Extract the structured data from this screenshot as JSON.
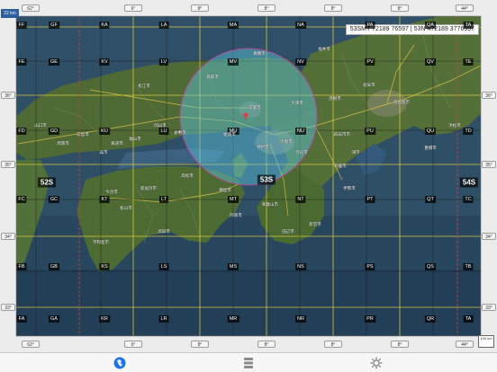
{
  "top_ticks": [
    "62°",
    "6°",
    "8°",
    "8°",
    "8°",
    "8°",
    "44°"
  ],
  "bottom_ticks": [
    "62°",
    "6°",
    "8°",
    "8°",
    "8°",
    "8°",
    "44°"
  ],
  "left_ticks": [
    "36°",
    "35°",
    "34°",
    "33°"
  ],
  "right_ticks": [
    "36°",
    "35°",
    "34°",
    "33°"
  ],
  "zoom_label": "22 km",
  "scale_label": "100 km",
  "coord_readout": "53SMT 72189 76597 | 53N 472189 3776597",
  "zone_labels": {
    "left": "52S",
    "center": "53S",
    "right": "54S"
  },
  "grid_squares": [
    [
      "FF",
      "GF",
      "KA",
      "LA",
      "MA",
      "NA",
      "PA",
      "QA",
      "TA"
    ],
    [
      "FE",
      "GE",
      "KV",
      "LV",
      "MV",
      "NV",
      "PV",
      "QV",
      "TE"
    ],
    [
      "FD",
      "GD",
      "KU",
      "LU",
      "MU",
      "NU",
      "PU",
      "QU",
      "TD"
    ],
    [
      "FC",
      "GC",
      "KT",
      "LT",
      "MT",
      "NT",
      "PT",
      "QT",
      "TC"
    ],
    [
      "FB",
      "GB",
      "KS",
      "LS",
      "MS",
      "NS",
      "PS",
      "QS",
      "TB"
    ],
    [
      "FA",
      "GA",
      "KR",
      "LR",
      "MR",
      "NR",
      "PR",
      "QR",
      "TA"
    ]
  ],
  "place_names": [
    "大阪市",
    "名古屋市",
    "京都市",
    "神戸市",
    "岡山市",
    "広島市",
    "高松市",
    "和歌山市",
    "松山市",
    "高知市",
    "徳島市",
    "奈良市",
    "津市",
    "岐阜市",
    "福井市",
    "鳥取市",
    "松江市",
    "福山市",
    "倉敷市",
    "姫路市",
    "豊橋市",
    "浜松市",
    "四日市市",
    "彦根市",
    "舞鶴市",
    "今治市",
    "新居浜市",
    "尾道市",
    "呉市",
    "山口市",
    "周南市",
    "宇和島市",
    "阿南市",
    "田辺市",
    "新宮市",
    "伊勢市",
    "鈴鹿市",
    "大津市"
  ],
  "tabbar": {
    "items": [
      {
        "icon": "globe-icon",
        "active": true
      },
      {
        "icon": "layers-icon",
        "active": false
      },
      {
        "icon": "settings-gear-icon",
        "active": false
      }
    ]
  },
  "colors": {
    "accent": "#1a73e8",
    "grid_yellow": "#e8d23a",
    "zone_red": "#d04040",
    "circle_fill": "#5ec8e0"
  }
}
